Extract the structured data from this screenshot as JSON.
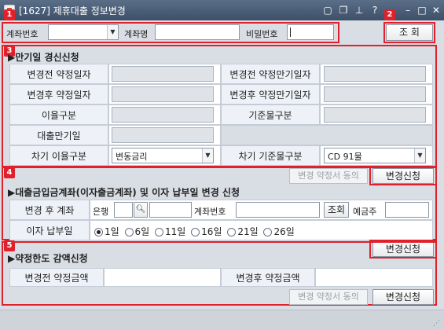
{
  "window": {
    "title": "[1627] 제휴대출 정보변경",
    "controls": [
      "restore-alt",
      "copy",
      "pin",
      "help",
      "minimize",
      "maximize",
      "close"
    ]
  },
  "badges": [
    "1",
    "2",
    "3",
    "4",
    "5"
  ],
  "search": {
    "account_label": "계좌번호",
    "account_value": "",
    "account_name_label": "계좌명",
    "account_name_value": "",
    "password_label": "비밀번호",
    "password_value": "",
    "query_button": "조 회"
  },
  "section3": {
    "title": "▶만기일 경신신청",
    "rows": [
      {
        "left_label": "변경전 약정일자",
        "right_label": "변경전 약정만기일자"
      },
      {
        "left_label": "변경후 약정일자",
        "right_label": "변경후 약정만기일자"
      },
      {
        "left_label": "이율구분",
        "right_label": "기준물구분"
      },
      {
        "left_label": "대출만기일"
      },
      {
        "left_label": "차기 이율구분",
        "left_value": "변동금리",
        "right_label": "차기 기준물구분",
        "right_value": "CD 91물"
      }
    ],
    "agreement_button": "변경 약정서 동의",
    "apply_button": "변경신청"
  },
  "section4": {
    "title": "▶대출금입금계좌(이자출금계좌) 및 이자 납부일 변경 신청",
    "account_row_label": "변경 후 계좌",
    "bank_label": "은행",
    "account_no_label": "계좌번호",
    "lookup_button": "조회",
    "depositor_label": "예금주",
    "payday_label": "이자 납부일",
    "payday_options": [
      "1일",
      "6일",
      "11일",
      "16일",
      "21일",
      "26일"
    ],
    "payday_selected": "1일",
    "apply_button": "변경신청"
  },
  "section5": {
    "title": "▶약정한도 감액신청",
    "before_label": "변경전 약정금액",
    "after_label": "변경후 약정금액",
    "agreement_button": "변경 약정서 동의",
    "apply_button": "변경신청"
  },
  "colors": {
    "titlebar": "#4a5c74",
    "annotation_red": "#e0202a",
    "panel": "#d9dde4",
    "label_cell": "#eef2f8"
  }
}
